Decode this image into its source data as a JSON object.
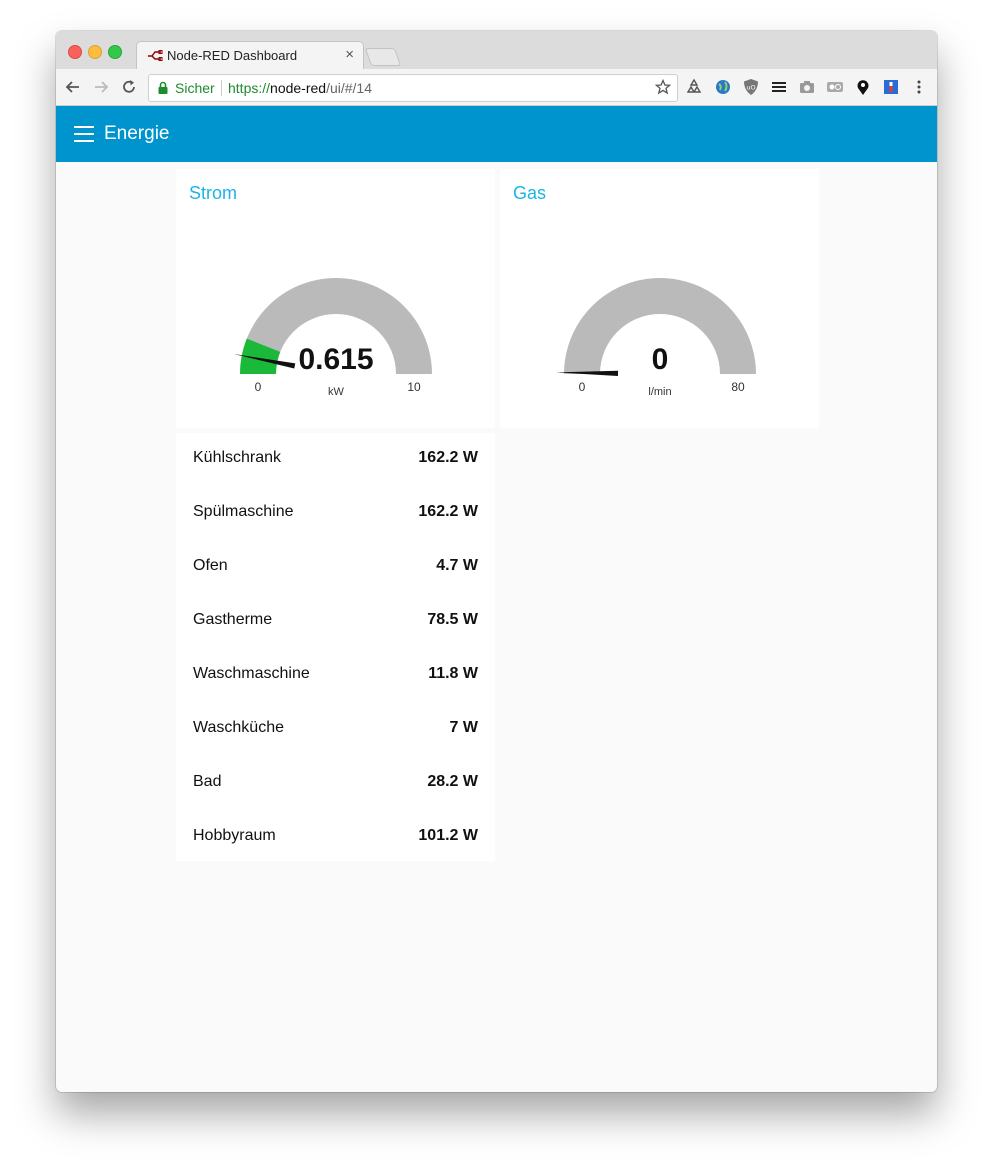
{
  "browser": {
    "tab_title": "Node-RED Dashboard",
    "tab_close": "×",
    "secure_label": "Sicher",
    "url_scheme": "https://",
    "url_host": "node-red",
    "url_path": "/ui/#/14",
    "icons": [
      "back-icon",
      "forward-icon",
      "reload-icon",
      "lock-icon",
      "star-icon",
      "recycle-icon",
      "globe-icon",
      "ublock-icon",
      "menu-lines-icon",
      "camera-icon",
      "toggle-icon",
      "maps-pin-icon",
      "flag-icon",
      "more-vert-icon"
    ]
  },
  "app": {
    "title": "Energie",
    "accent_color": "#0094ce"
  },
  "gauges": [
    {
      "title": "Strom",
      "value": 0.615,
      "value_label": "0.615",
      "unit": "kW",
      "min": 0,
      "max": 10,
      "min_label": "0",
      "max_label": "10",
      "fill_color": "#1ab939"
    },
    {
      "title": "Gas",
      "value": 0,
      "value_label": "0",
      "unit": "l/min",
      "min": 0,
      "max": 80,
      "min_label": "0",
      "max_label": "80",
      "fill_color": "#1ab939"
    }
  ],
  "consumers": [
    {
      "name": "Kühlschrank",
      "value": "162.2 W"
    },
    {
      "name": "Spülmaschine",
      "value": "162.2 W"
    },
    {
      "name": "Ofen",
      "value": "4.7 W"
    },
    {
      "name": "Gastherme",
      "value": "78.5 W"
    },
    {
      "name": "Waschmaschine",
      "value": "11.8 W"
    },
    {
      "name": "Waschküche",
      "value": "7 W"
    },
    {
      "name": "Bad",
      "value": "28.2 W"
    },
    {
      "name": "Hobbyraum",
      "value": "101.2 W"
    }
  ]
}
